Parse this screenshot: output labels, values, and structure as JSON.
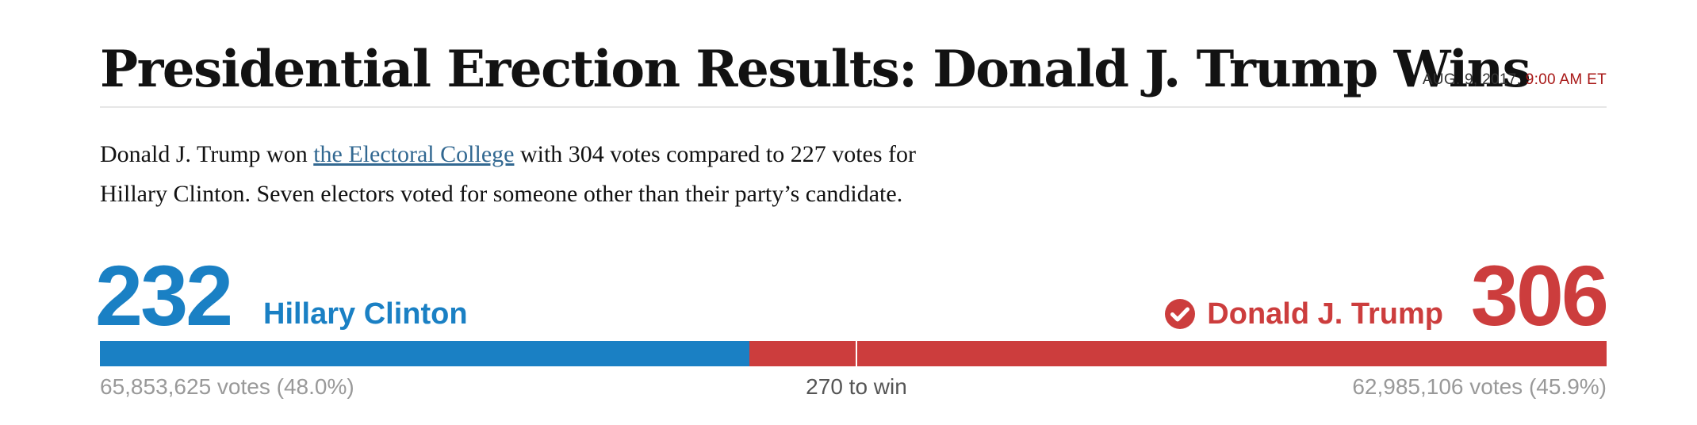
{
  "headline": "Presidential Erection Results: Donald J. Trump Wins",
  "dateline": {
    "date": "AUG. 9, 2017, ",
    "time": "9:00 AM ET"
  },
  "summary": {
    "before_link": "Donald J. Trump won ",
    "link": "the Electoral College",
    "after_link_line1": " with 304 votes compared to 227 votes for",
    "line2": "Hillary Clinton. Seven electors voted for someone other than their party’s candidate."
  },
  "results": {
    "dem": {
      "electoral": "232",
      "name": "Hillary Clinton",
      "popular": "65,853,625 votes (48.0%)",
      "electoral_value": 232,
      "color": "#1a80c4"
    },
    "rep": {
      "electoral": "306",
      "name": "Donald J. Trump",
      "popular": "62,985,106 votes (45.9%)",
      "electoral_value": 306,
      "color": "#cc3d3d",
      "winner_icon": "check-circle-icon"
    },
    "threshold_label": "270 to win",
    "threshold_value": 270,
    "total_electoral": 538
  }
}
